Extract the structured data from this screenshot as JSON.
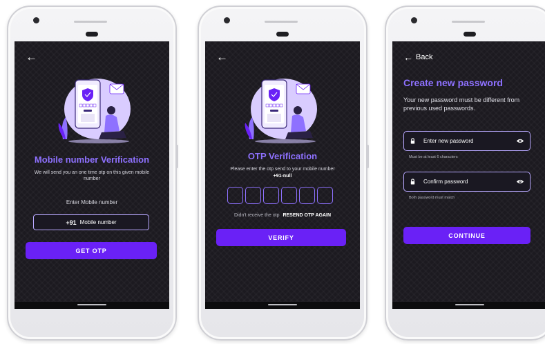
{
  "screen1": {
    "title": "Mobile number Verification",
    "subtitle": "We will send you an one time otp on this given mobile number",
    "field_label": "Enter Mobile number",
    "country_code": "+91",
    "mobile_placeholder": "Mobile number",
    "button_label": "GET OTP"
  },
  "screen2": {
    "title": "OTP Verification",
    "subtitle": "Please enter the otp send to your mobile number",
    "phone": "+91-null",
    "otp_box_count": 6,
    "resend_prompt": "Didn't receive the otp",
    "resend_label": "RESEND OTP AGAIN",
    "button_label": "VERIFY"
  },
  "screen3": {
    "back_label": "Back",
    "title": "Create new password",
    "subtitle": "Your new password must be different from previous used passwords.",
    "new_password_placeholder": "Enter new password",
    "new_password_hint": "Must be at least 6 characters",
    "confirm_password_placeholder": "Confirm password",
    "confirm_password_hint": "Both password must match",
    "button_label": "CONTINUE"
  },
  "icons": {
    "back": "back-arrow-icon",
    "lock": "lock-icon",
    "eye": "eye-icon"
  },
  "colors": {
    "screen_bg": "#1c1a20",
    "accent": "#8e71ff",
    "button": "#6a21f6",
    "field_border": "#b8a8ff"
  }
}
